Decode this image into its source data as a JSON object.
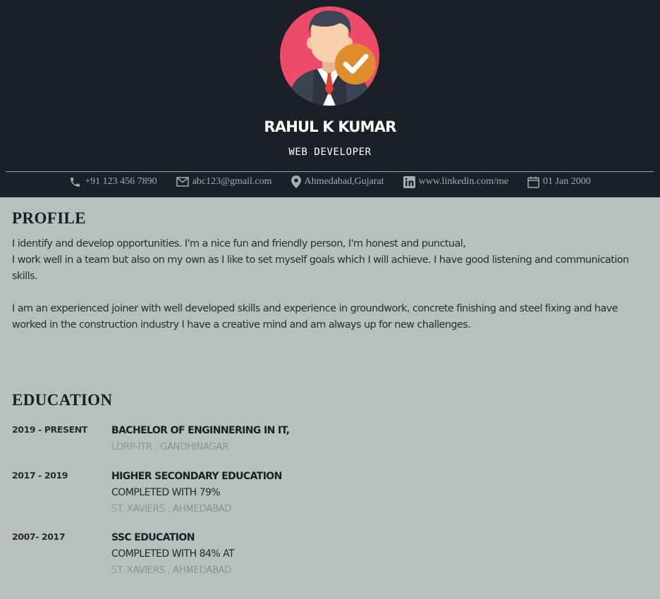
{
  "header": {
    "name": "RAHUL K KUMAR",
    "role": "WEB DEVELOPER",
    "avatar_icon": "businessman-verified-icon",
    "colors": {
      "background": "#1b1f28",
      "avatar_circle": "#ee4b6b",
      "badge": "#df8d2c"
    }
  },
  "contacts": [
    {
      "icon": "phone-icon",
      "text": "+91 123 456 7890"
    },
    {
      "icon": "envelope-icon",
      "text": "abc123@gmail.com"
    },
    {
      "icon": "map-pin-icon",
      "text": "Ahmedabad,Gujarat"
    },
    {
      "icon": "linkedin-icon",
      "text": "www.linkedin.com/me"
    },
    {
      "icon": "calendar-icon",
      "text": "01 Jan 2000"
    }
  ],
  "profile": {
    "title": "PROFILE",
    "paragraph_1_line_1": "I identify and develop opportunities. I'm a nice fun and friendly person, I'm honest and punctual,",
    "paragraph_1_line_2": "I work well in a team but also on my own as I like to set myself goals which I will achieve. I have good listening and communication skills.",
    "paragraph_2": "I am an experienced joiner with well developed skills and experience in groundwork, concrete finishing and steel fixing and have worked in the construction industry I have a creative mind and am always up for new challenges."
  },
  "education": {
    "title": "EDUCATION",
    "items": [
      {
        "years": "2019 - PRESENT",
        "degree": "BACHELOR OF ENGINNERING IN IT,",
        "detail": "",
        "school": "LDRP-ITR , GANDHINAGAR"
      },
      {
        "years": "2017 - 2019",
        "degree": "HIGHER SECONDARY EDUCATION",
        "detail": "COMPLETED WITH 79%",
        "school": "ST. XAVIERS , AHMEDABAD"
      },
      {
        "years": "2007- 2017",
        "degree": "SSC EDUCATION",
        "detail": "COMPLETED WITH 84% AT",
        "school": "ST. XAVIERS , AHMEDABAD"
      }
    ]
  },
  "colors": {
    "page_background": "#b6c1bd",
    "text": "#1c1f26",
    "muted": "#6c7171",
    "contact_text": "#a6adad"
  }
}
